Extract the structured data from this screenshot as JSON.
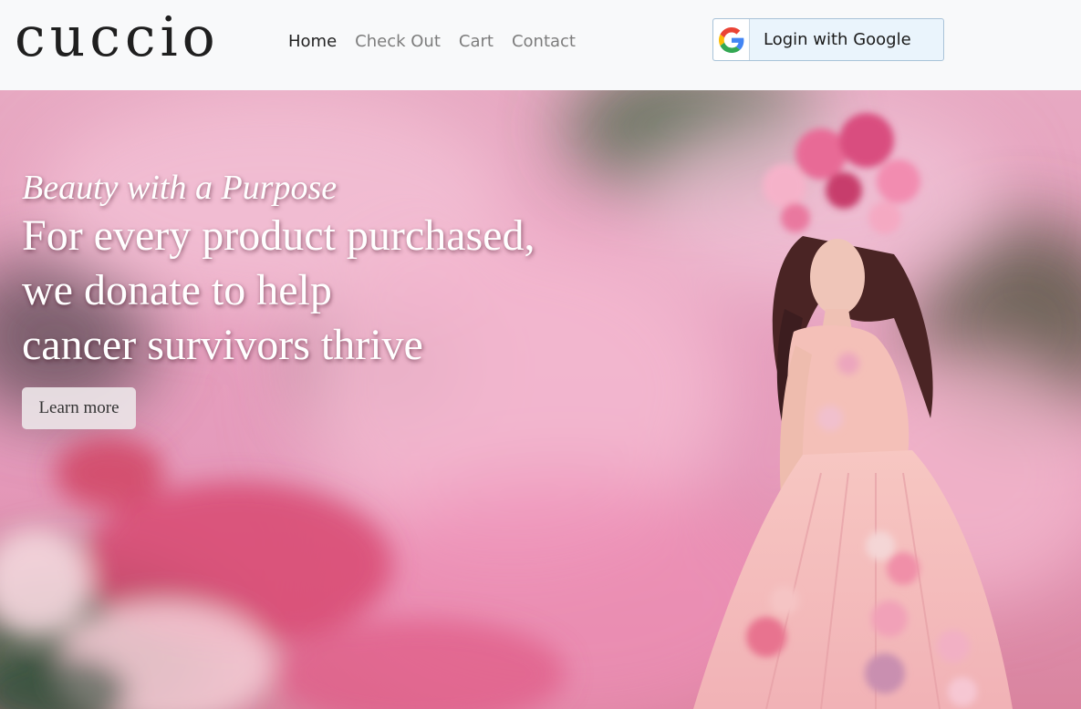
{
  "brand": {
    "logo_text": "cuccio"
  },
  "nav": {
    "items": [
      {
        "label": "Home",
        "active": true
      },
      {
        "label": "Check Out",
        "active": false
      },
      {
        "label": "Cart",
        "active": false
      },
      {
        "label": "Contact",
        "active": false
      }
    ]
  },
  "login": {
    "label": "Login with Google",
    "icon": "google-g-icon"
  },
  "hero": {
    "tagline": "Beauty with a Purpose",
    "headline_lines": [
      "For every product purchased,",
      "we donate to help",
      "cancer survivors thrive"
    ],
    "cta_label": "Learn more",
    "image": "woman-in-pink-gown-with-flower-crown-in-pink-smoke"
  },
  "colors": {
    "nav_bg": "#f8f9fa",
    "login_bg": "#eaf4fc",
    "login_border": "#a9c3d8",
    "hero_pink": "#e9a9c3",
    "text_dark": "#222222"
  }
}
